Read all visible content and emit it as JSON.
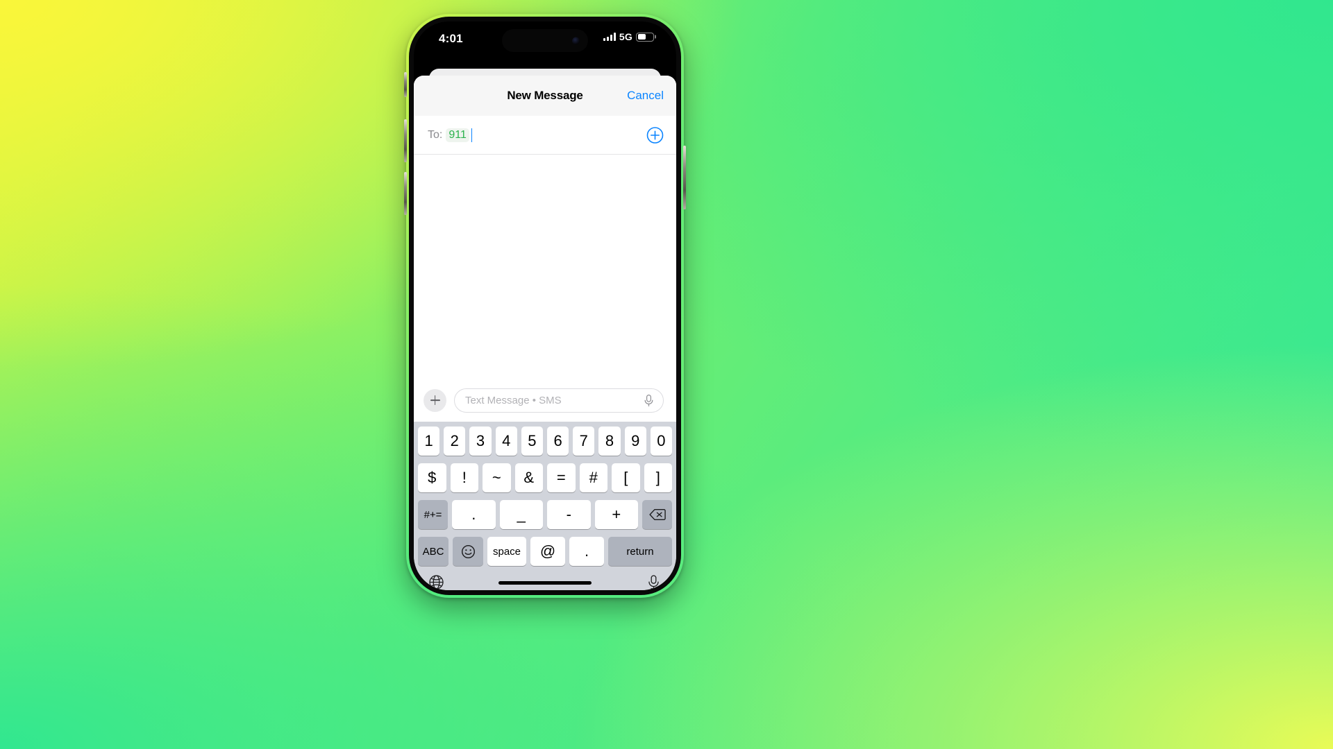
{
  "background": {
    "accent_yellow": "#FAF63A",
    "accent_green": "#2EE89A",
    "accent_lime": "#E9FB56"
  },
  "device": {
    "frame_color": "#b8b2a4",
    "buttons": [
      "action-button",
      "volume-up-button",
      "volume-down-button",
      "power-button"
    ]
  },
  "status_bar": {
    "time": "4:01",
    "network": "5G",
    "signal_bars": 4,
    "battery_percent": 45,
    "icons": [
      "cellular-signal-icon",
      "battery-icon",
      "camera-lens-icon"
    ]
  },
  "nav_bar": {
    "title": "New Message",
    "cancel_label": "Cancel"
  },
  "to_field": {
    "label": "To:",
    "recipient": "911",
    "recipient_color": "#2bb24c",
    "add_contact_icon": "add-contact-plus-circle-icon"
  },
  "compose_bar": {
    "attach_icon": "plus-attach-icon",
    "placeholder": "Text Message • SMS",
    "mic_icon": "microphone-icon"
  },
  "keyboard": {
    "rows": [
      {
        "name": "number-row",
        "keys": [
          "1",
          "2",
          "3",
          "4",
          "5",
          "6",
          "7",
          "8",
          "9",
          "0"
        ]
      },
      {
        "name": "symbol-row",
        "keys": [
          "$",
          "!",
          "~",
          "&",
          "=",
          "#",
          "[",
          "]"
        ]
      },
      {
        "name": "punctuation-row",
        "keys": [
          ".",
          "_",
          "-",
          "+"
        ]
      }
    ],
    "symbols_shift_label": "#+=",
    "backspace_label": "delete-backspace-icon",
    "abc_label": "ABC",
    "emoji_label": "emoji-smiley-icon",
    "space_label": "space",
    "at_label": "@",
    "period_label": ".",
    "return_label": "return",
    "globe_icon": "globe-language-icon",
    "dictation_icon": "microphone-dictation-icon",
    "background_color": "#d1d4db",
    "key_color": "#ffffff",
    "modifier_key_color": "#aeb3bd"
  }
}
